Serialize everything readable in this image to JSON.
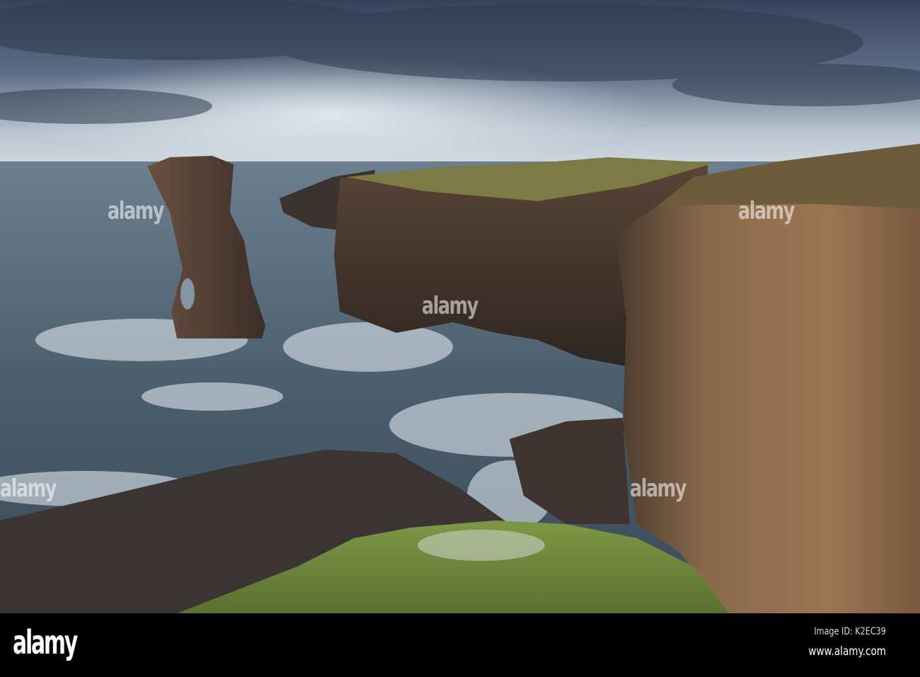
{
  "photo": {
    "subject": "sea-stack-and-sandstone-cliffs",
    "colors": {
      "sky_top": "#3e4d63",
      "sky_horizon": "#c9d3dc",
      "sea": "#4f6272",
      "cliff": "#6e5440",
      "grass": "#6e8a3a"
    }
  },
  "watermark": {
    "text": "alamy"
  },
  "footer": {
    "logo": "alamy",
    "image_id": "Image ID: K2EC39",
    "website": "www.alamy.com"
  }
}
